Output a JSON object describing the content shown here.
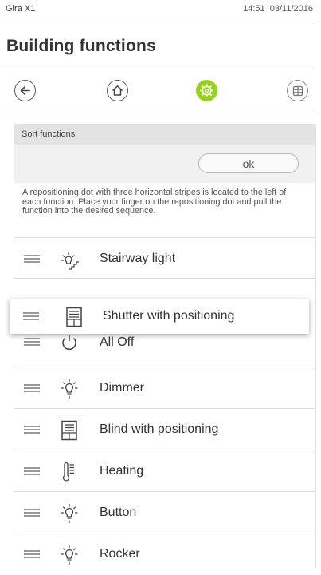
{
  "statusbar": {
    "device": "Gira X1",
    "time": "14:51",
    "date": "03/11/2016"
  },
  "header": {
    "title": "Building functions"
  },
  "nav": {
    "back_icon": "arrow-left-icon",
    "home_icon": "home-icon",
    "settings_icon": "gear-icon",
    "grid_icon": "grid-icon",
    "active_color": "#97d21a"
  },
  "sort": {
    "header": "Sort functions",
    "ok_label": "ok",
    "description": "A repositioning dot with three horizontal stripes is located to the left of each function. Place your finger on the repositioning dot and pull the function into the desired sequence."
  },
  "functions": [
    {
      "label": "Stairway light",
      "icon": "stairway-light-icon"
    },
    {
      "label": "Shutter with positioning",
      "icon": "shutter-icon",
      "dragging": true
    },
    {
      "label": "All Off",
      "icon": "power-icon"
    },
    {
      "label": "Dimmer",
      "icon": "bulb-icon"
    },
    {
      "label": "Blind with positioning",
      "icon": "blind-icon"
    },
    {
      "label": "Heating",
      "icon": "thermometer-icon"
    },
    {
      "label": "Button",
      "icon": "bulb-icon"
    },
    {
      "label": "Rocker",
      "icon": "bulb-icon"
    }
  ]
}
